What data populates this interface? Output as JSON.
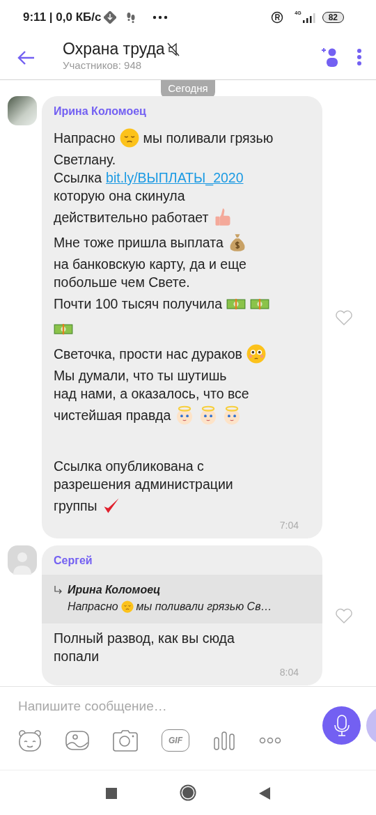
{
  "status_bar": {
    "time_speed": "9:11 | 0,0 КБ/с",
    "network": "4G",
    "battery": "82"
  },
  "header": {
    "title": "Охрана труда",
    "muted": true,
    "subtitle": "Участников: 948"
  },
  "date_chip": "Сегодня",
  "messages": [
    {
      "sender": "Ирина Коломоец",
      "avatar": {
        "kind": "photo"
      },
      "liked": false,
      "time": "7:04",
      "lines": [
        {
          "kind": "text",
          "parts": [
            {
              "kind": "text",
              "text": "Напрасно"
            },
            {
              "kind": "sad"
            },
            {
              "kind": "text",
              "text": "мы поливали грязью"
            }
          ]
        },
        {
          "kind": "text",
          "parts": [
            {
              "kind": "text",
              "text": "Светлану."
            }
          ]
        },
        {
          "kind": "text",
          "parts": [
            {
              "kind": "text",
              "text": "Ссылка"
            },
            {
              "kind": "link",
              "text": "bit.ly/ВЫПЛАТЫ_2020"
            }
          ]
        },
        {
          "kind": "text",
          "parts": [
            {
              "kind": "text",
              "text": "которую она скинула"
            }
          ]
        },
        {
          "kind": "text",
          "parts": [
            {
              "kind": "text",
              "text": "действительно работает"
            },
            {
              "kind": "thumb"
            }
          ]
        },
        {
          "kind": "text",
          "parts": [
            {
              "kind": "text",
              "text": "Мне тоже пришла выплата"
            },
            {
              "kind": "moneybag"
            }
          ]
        },
        {
          "kind": "text",
          "parts": [
            {
              "kind": "text",
              "text": "на банковскую карту, да и еще"
            }
          ]
        },
        {
          "kind": "text",
          "parts": [
            {
              "kind": "text",
              "text": "побольше чем Свете."
            }
          ]
        },
        {
          "kind": "text",
          "parts": [
            {
              "kind": "text",
              "text": "Почти 100 тысяч получила"
            },
            {
              "kind": "cash"
            },
            {
              "kind": "cash"
            }
          ]
        },
        {
          "kind": "text",
          "parts": [
            {
              "kind": "cash"
            }
          ]
        },
        {
          "kind": "text",
          "parts": [
            {
              "kind": "text",
              "text": "Светочка, прости нас дураков"
            },
            {
              "kind": "pleading"
            }
          ]
        },
        {
          "kind": "text",
          "parts": [
            {
              "kind": "text",
              "text": "Мы думали, что ты шутишь"
            }
          ]
        },
        {
          "kind": "text",
          "parts": [
            {
              "kind": "text",
              "text": "над нами, а оказалось, что все"
            }
          ]
        },
        {
          "kind": "text",
          "parts": [
            {
              "kind": "text",
              "text": "чистейшая правда"
            },
            {
              "kind": "angel"
            },
            {
              "kind": "angel"
            },
            {
              "kind": "angel"
            }
          ]
        },
        {
          "kind": "blank"
        },
        {
          "kind": "text",
          "parts": [
            {
              "kind": "text",
              "text": "Ссылка опубликована с"
            }
          ]
        },
        {
          "kind": "text",
          "parts": [
            {
              "kind": "text",
              "text": "разрешения администрации"
            }
          ]
        },
        {
          "kind": "text",
          "parts": [
            {
              "kind": "text",
              "text": "группы"
            },
            {
              "kind": "check"
            }
          ]
        }
      ]
    },
    {
      "sender": "Сергей",
      "avatar": {
        "kind": "silhouette"
      },
      "liked": false,
      "time": "8:04",
      "reply": {
        "author": "Ирина Коломоец",
        "parts": [
          {
            "kind": "text",
            "text": "Напрасно"
          },
          {
            "kind": "sad"
          },
          {
            "kind": "text",
            "text": "мы поливали грязью Св…"
          }
        ]
      },
      "lines": [
        {
          "kind": "text",
          "parts": [
            {
              "kind": "text",
              "text": "Полный развод, как вы сюда"
            }
          ]
        },
        {
          "kind": "text",
          "parts": [
            {
              "kind": "text",
              "text": "попали"
            }
          ]
        }
      ]
    }
  ],
  "composer": {
    "placeholder": "Напишите сообщение…",
    "gif_label": "GIF"
  }
}
